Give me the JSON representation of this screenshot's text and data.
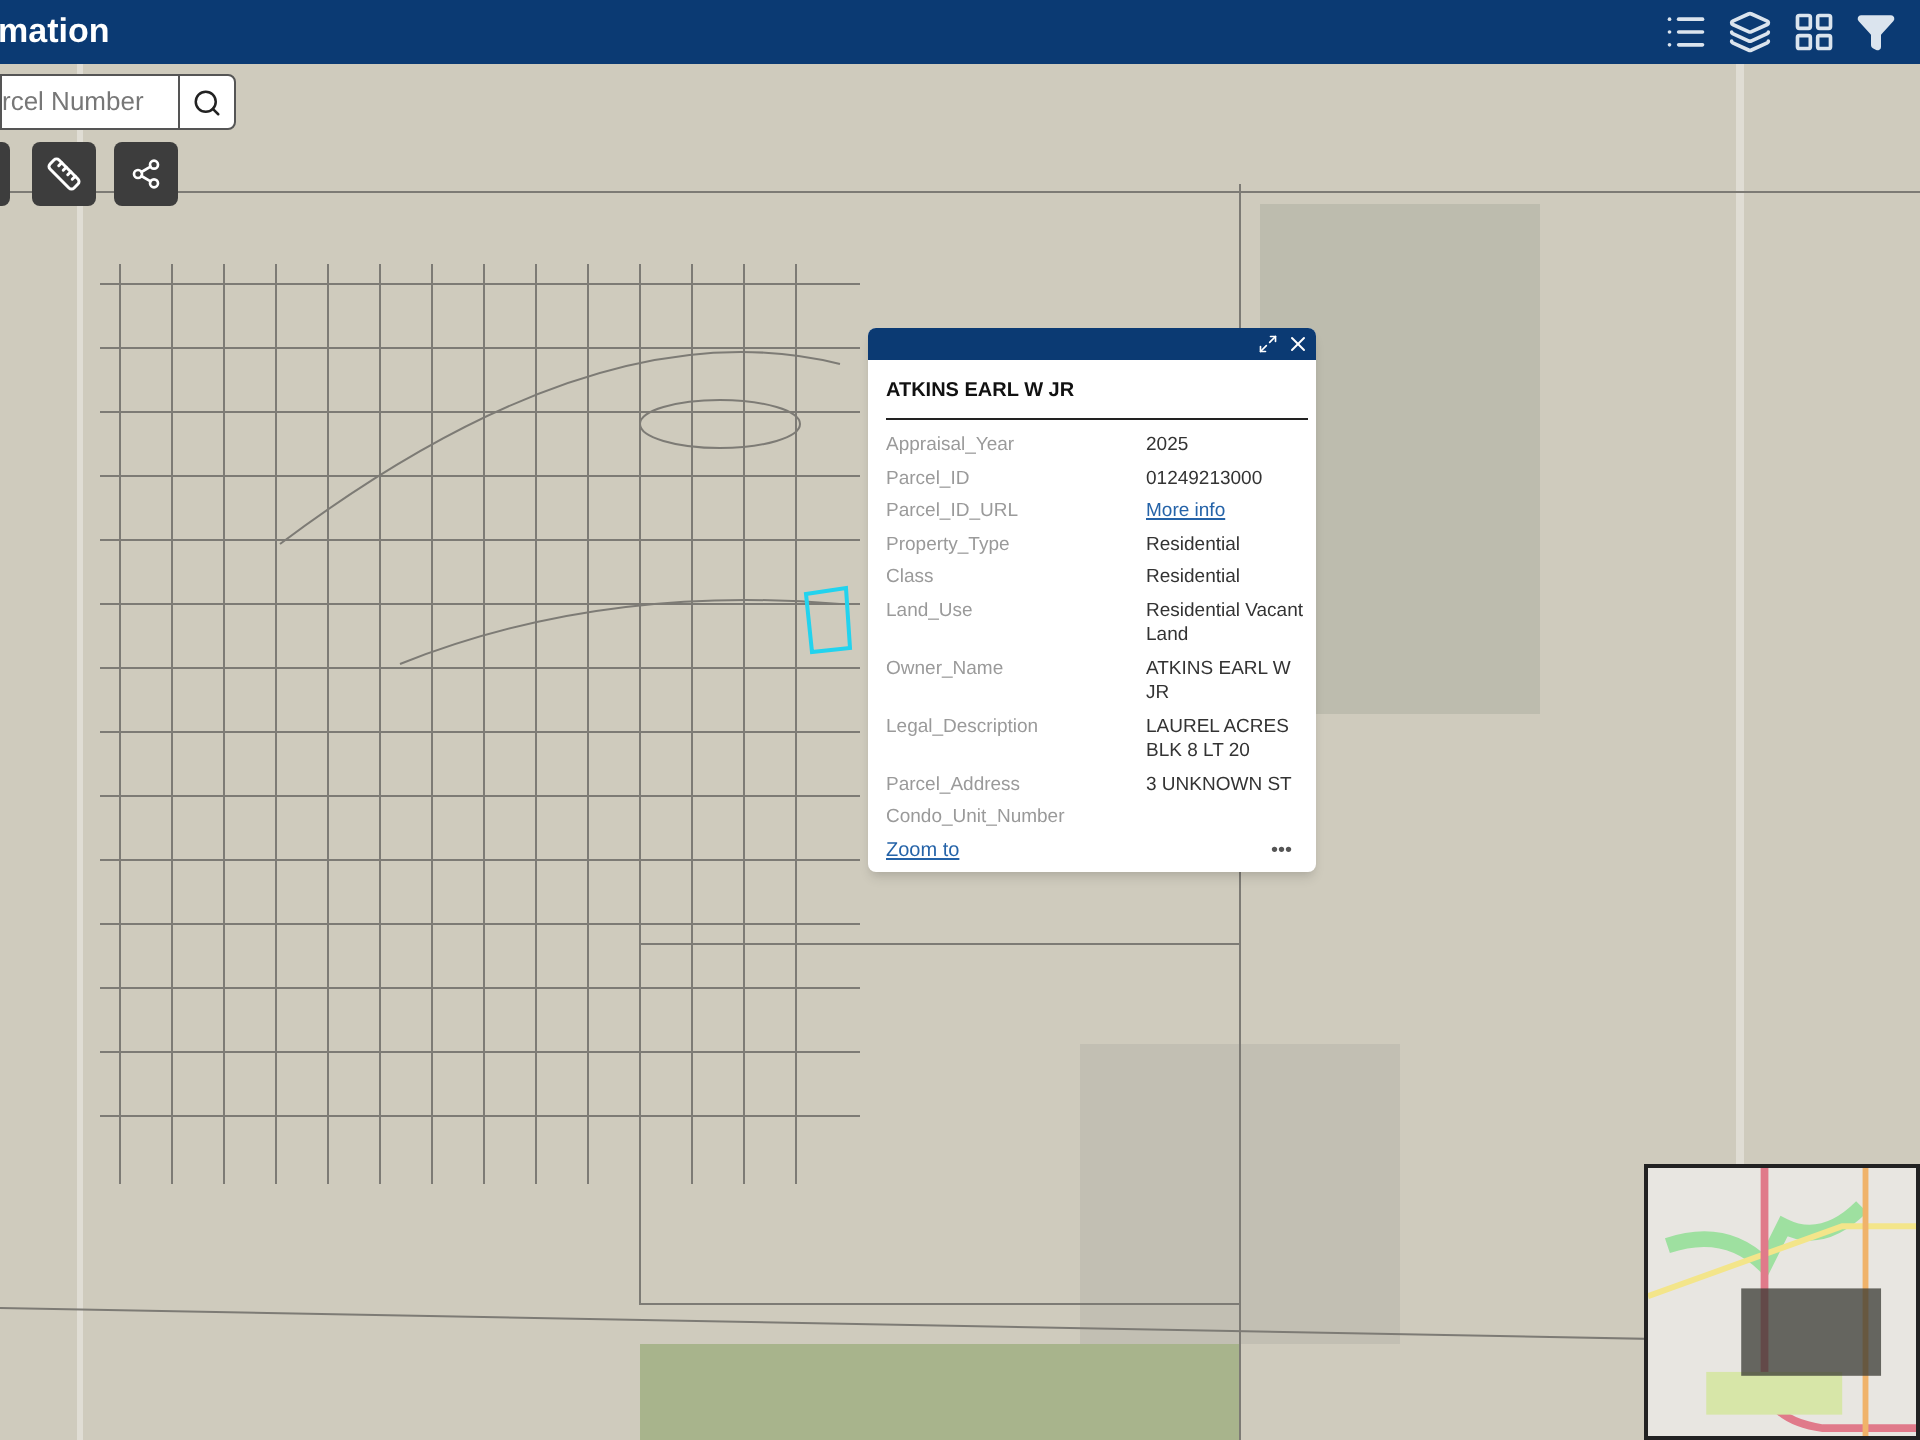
{
  "header": {
    "title": "mation"
  },
  "search": {
    "placeholder": "rcel Number"
  },
  "popup": {
    "title": "ATKINS EARL W JR",
    "fields": [
      {
        "label": "Appraisal_Year",
        "value": "2025",
        "kind": "text"
      },
      {
        "label": "Parcel_ID",
        "value": "01249213000",
        "kind": "text"
      },
      {
        "label": "Parcel_ID_URL",
        "value": "More info",
        "kind": "link"
      },
      {
        "label": "Property_Type",
        "value": "Residential",
        "kind": "text"
      },
      {
        "label": "Class",
        "value": "Residential",
        "kind": "text"
      },
      {
        "label": "Land_Use",
        "value": "Residential Vacant Land",
        "kind": "text"
      },
      {
        "label": "Owner_Name",
        "value": "ATKINS EARL W JR",
        "kind": "text"
      },
      {
        "label": "Legal_Description",
        "value": "LAUREL ACRES BLK 8 LT 20",
        "kind": "text"
      },
      {
        "label": "Parcel_Address",
        "value": "3 UNKNOWN ST",
        "kind": "text"
      },
      {
        "label": "Condo_Unit_Number",
        "kind": "text"
      }
    ],
    "zoom_link": "Zoom to",
    "more": "•••"
  }
}
